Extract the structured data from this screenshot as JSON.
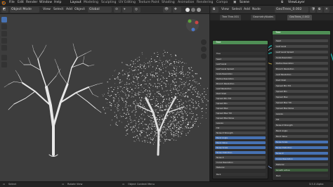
{
  "topbar": {
    "menus": [
      "File",
      "Edit",
      "Render",
      "Window",
      "Help"
    ],
    "workspaces": [
      "Layout",
      "Modeling",
      "Sculpting",
      "UV Editing",
      "Texture Paint",
      "Shading",
      "Animation",
      "Rendering",
      "Compo"
    ],
    "scene": "Scene",
    "view_layer": "ViewLayer"
  },
  "viewport_header": {
    "mode": "Object Mode",
    "menus": [
      "View",
      "Select",
      "Add",
      "Object"
    ],
    "transform": "Global",
    "options": "Options"
  },
  "node_editor": {
    "header_menus": [
      "View",
      "Select",
      "Add",
      "Node"
    ],
    "tree_name": "GeoTrees_0.002",
    "breadcrumbs": [
      "Tree Tree.001",
      "GeometryNodes",
      "GeoTrees_0.002"
    ],
    "left_node": {
      "title": "Tree",
      "dropdown": "Tree",
      "fields": [
        "Seed",
        "Leaf Level",
        "Leaf Level Spread",
        "Scale Resolution",
        "Radius Resolution",
        "Branch Resolution",
        "Leaf Resolution",
        "Root Shell",
        "Spread Min Tilt",
        "Spread Min",
        "Spread Max",
        "Spread Max Tilt",
        "Spread Max Noise",
        "Leaves",
        "Tilt",
        "Noise Z Strength",
        "Bend Angle",
        "Bend Value",
        "Noise Scale",
        "Noise Distortion",
        "Noise Z",
        "Curve Resolution",
        "Material"
      ],
      "footer": "Bark"
    },
    "right_node": {
      "title": "Tree",
      "fields": [
        "Seed",
        "Leaf Level",
        "Leaf Level Spread",
        "Scale Resolution",
        "Radius Resolution",
        "Branch Resolution",
        "Leaf Resolution",
        "Root Shell",
        "Spread Min Tilt",
        "Spread Min",
        "Spread Max",
        "Spread Max Tilt",
        "Spread Max Noise",
        "Leaves",
        "Tilt",
        "Noise Z Strength",
        "Bend Angle",
        "Bend Value",
        "Noise Scale",
        "Noise Distortion",
        "Noise Z",
        "Curve Resolution",
        "Material"
      ],
      "footer": "Bark",
      "extra": [
        "Growth active"
      ]
    }
  },
  "statusbar": {
    "select": "Select",
    "rotate": "Rotate View",
    "context": "Object Context Menu",
    "version": "3.5.0 Alpha"
  }
}
